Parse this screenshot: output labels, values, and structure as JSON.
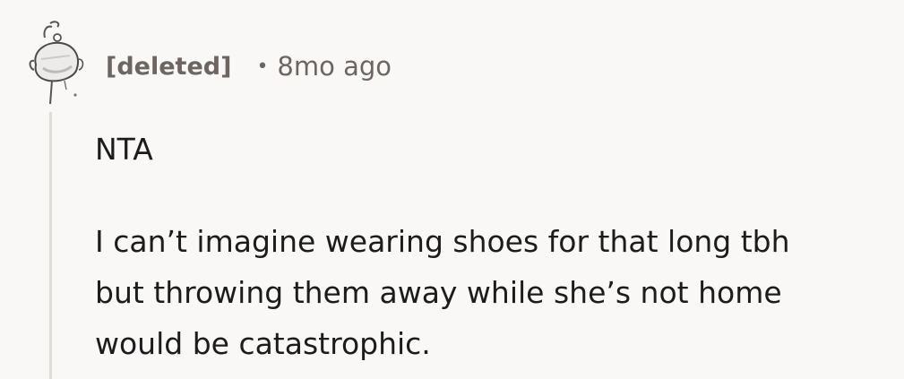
{
  "comment": {
    "author": "[deleted]",
    "separator": "•",
    "timestamp": "8mo ago",
    "paragraphs": [
      [
        "NTA"
      ],
      [
        "I can’t imagine wearing shoes for that long tbh",
        "but throwing them away while she’s not home",
        "would be catastrophic."
      ]
    ]
  },
  "colors": {
    "background": "#f9f8f7",
    "meta_text": "#6e6560",
    "body_text": "#1c1c1c",
    "thread_line": "#e2dcd6"
  },
  "icons": {
    "avatar": "deleted-user-snoo-avatar"
  }
}
